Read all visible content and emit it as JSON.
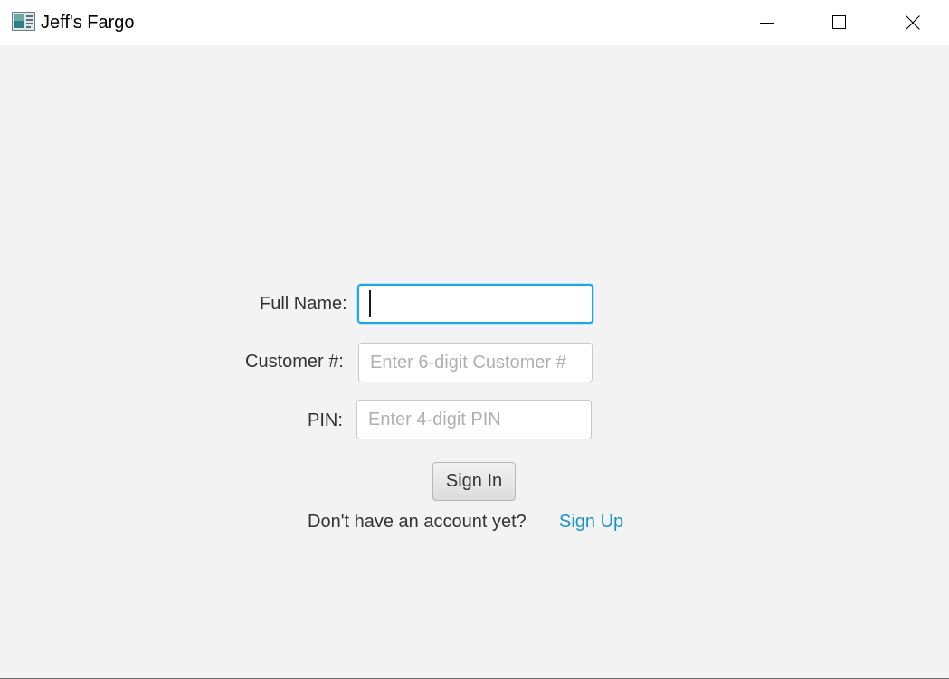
{
  "window": {
    "title": "Jeff's Fargo",
    "icon": "app-window-icon",
    "controls": {
      "minimize_icon": "minimize-icon",
      "maximize_icon": "maximize-icon",
      "close_icon": "close-icon"
    }
  },
  "form": {
    "full_name_label": "Full Name:",
    "full_name_value": "",
    "full_name_placeholder": "",
    "customer_label": "Customer #:",
    "customer_value": "",
    "customer_placeholder": "Enter 6-digit Customer #",
    "pin_label": "PIN:",
    "pin_value": "",
    "pin_placeholder": "Enter 4-digit PIN",
    "sign_in_label": "Sign In",
    "signup_prompt": "Don't have an account yet?",
    "signup_link": "Sign Up"
  },
  "colors": {
    "background": "#f3f3f3",
    "focus_border": "#1aa7e0",
    "link": "#1a95c9",
    "text": "#333333",
    "placeholder": "#b0b0b0"
  }
}
